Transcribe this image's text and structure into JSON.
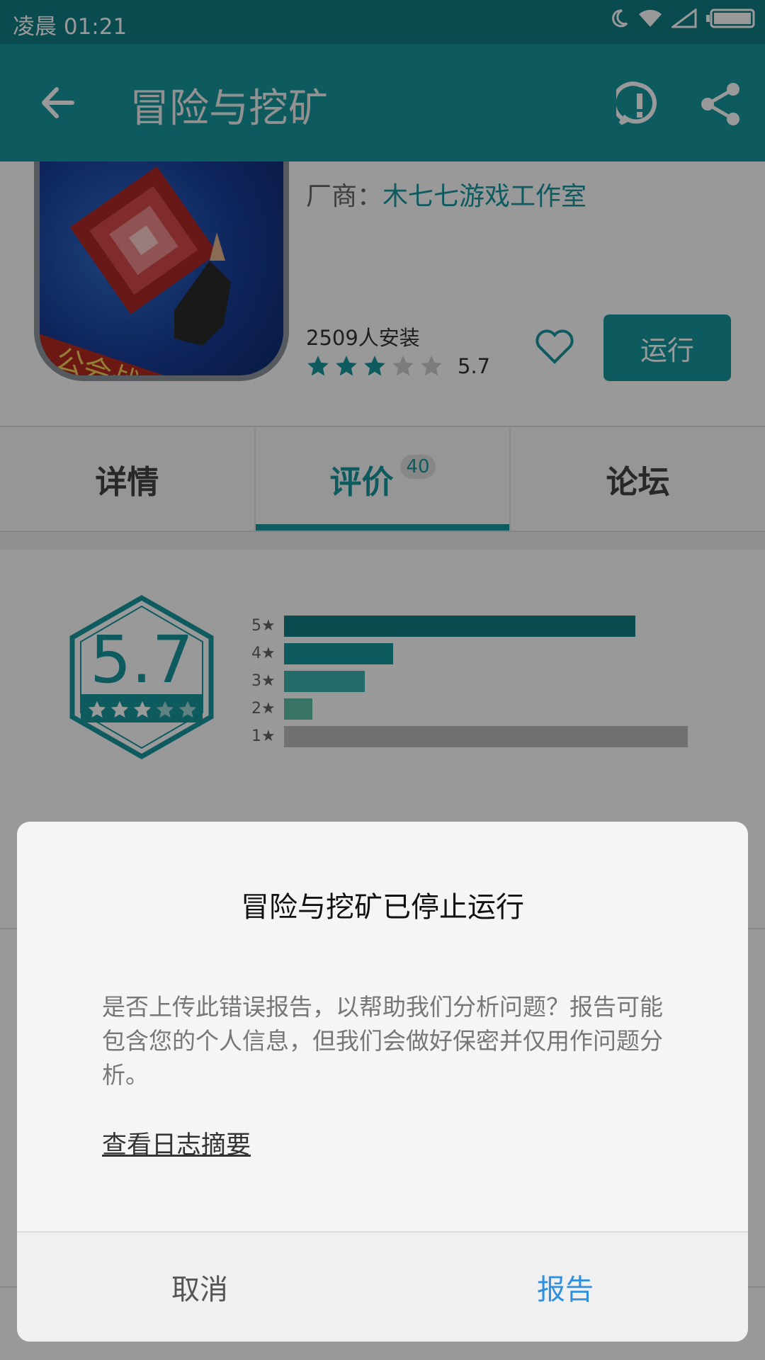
{
  "status_bar": {
    "time": "凌晨 01:21"
  },
  "app_bar": {
    "title": "冒险与挖矿"
  },
  "app": {
    "vendor_label": "厂商：",
    "vendor_name": "木七七游戏工作室",
    "installs": "2509人安装",
    "rating": "5.7",
    "rating_stars_filled": 3,
    "rating_stars_total": 5,
    "run_label": "运行"
  },
  "tabs": [
    {
      "label": "详情"
    },
    {
      "label": "评价",
      "badge": "40"
    },
    {
      "label": "论坛"
    }
  ],
  "rating_summary": {
    "score": "5.7",
    "bars": [
      {
        "label": "5★",
        "fraction": 0.87,
        "color": "#127d85"
      },
      {
        "label": "4★",
        "fraction": 0.27,
        "color": "#17969e"
      },
      {
        "label": "3★",
        "fraction": 0.2,
        "color": "#3bb5b0"
      },
      {
        "label": "2★",
        "fraction": 0.07,
        "color": "#5cc2aa"
      },
      {
        "label": "1★",
        "fraction": 1.0,
        "color": "#bdbdbd"
      }
    ]
  },
  "dialog": {
    "title": "冒险与挖矿已停止运行",
    "message": "是否上传此错误报告，以帮助我们分析问题？报告可能包含您的个人信息，但我们会做好保密并仅用作问题分析。",
    "log_link": "查看日志摘要",
    "cancel": "取消",
    "report": "报告"
  },
  "colors": {
    "accent": "#17969e",
    "status_bar": "#127d85",
    "report_button": "#2f8fe0"
  }
}
